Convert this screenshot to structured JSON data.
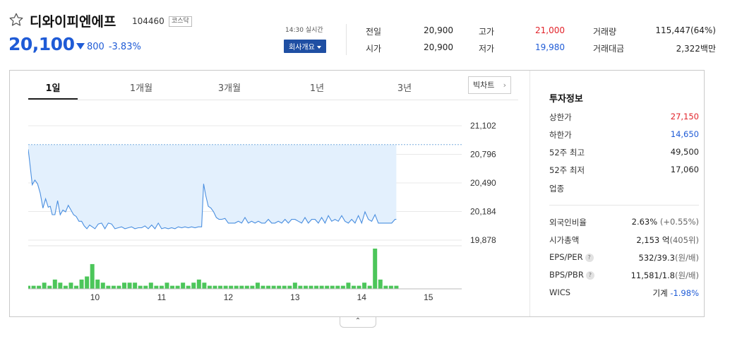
{
  "stock": {
    "name": "디와이피엔에프",
    "code": "104460",
    "market": "코스닥",
    "price": "20,100",
    "change": "800",
    "change_pct": "-3.83%",
    "realtime": "14:30 실시간",
    "company_btn": "회사개요"
  },
  "quotes": [
    {
      "label": "전일",
      "value": "20,900",
      "color": "normal"
    },
    {
      "label": "고가",
      "value": "21,000",
      "color": "red"
    },
    {
      "label": "거래량",
      "value": "115,447(64%)",
      "color": "normal"
    },
    {
      "label": "시가",
      "value": "20,900",
      "color": "normal"
    },
    {
      "label": "저가",
      "value": "19,980",
      "color": "blue"
    },
    {
      "label": "거래대금",
      "value": "2,322백만",
      "color": "normal"
    }
  ],
  "tabs": [
    {
      "label": "1일",
      "active": true
    },
    {
      "label": "1개월",
      "active": false
    },
    {
      "label": "3개월",
      "active": false
    },
    {
      "label": "1년",
      "active": false
    },
    {
      "label": "3년",
      "active": false
    }
  ],
  "big_chart_btn": "빅차트",
  "invest": {
    "title": "투자정보",
    "rows": [
      {
        "label": "상한가",
        "value": "27,150",
        "color": "red"
      },
      {
        "label": "하한가",
        "value": "14,650",
        "color": "blue"
      },
      {
        "label": "52주 최고",
        "value": "49,500"
      },
      {
        "label": "52주 최저",
        "value": "17,060"
      },
      {
        "label": "업종",
        "value": ""
      }
    ],
    "rows2": [
      {
        "label": "외국인비율",
        "value": "2.63%",
        "sub": "(+0.55%)"
      },
      {
        "label": "시가총액",
        "value": "2,153 억",
        "sub": "(405위)"
      },
      {
        "label": "EPS/PER",
        "value": "532/39.3",
        "sub": "(원/배)",
        "help": "?"
      },
      {
        "label": "BPS/PBR",
        "value": "11,581/1.8",
        "sub": "(원/배)",
        "help": "?"
      },
      {
        "label": "WICS",
        "value": "기계",
        "sub": "-1.98%"
      }
    ]
  },
  "chart_data": {
    "type": "line",
    "y_ticks": [
      "21,102",
      "20,796",
      "20,490",
      "20,184",
      "19,878"
    ],
    "ylim": [
      19878,
      21102
    ],
    "prev_close": 20900,
    "x_ticks": [
      "10",
      "11",
      "12",
      "13",
      "14",
      "15"
    ],
    "x_range": [
      9,
      15.5
    ],
    "price_series": [
      [
        9.0,
        20850
      ],
      [
        9.06,
        20470
      ],
      [
        9.1,
        20520
      ],
      [
        9.14,
        20480
      ],
      [
        9.18,
        20380
      ],
      [
        9.22,
        20220
      ],
      [
        9.26,
        20320
      ],
      [
        9.3,
        20230
      ],
      [
        9.33,
        20240
      ],
      [
        9.36,
        20150
      ],
      [
        9.4,
        20150
      ],
      [
        9.44,
        20300
      ],
      [
        9.48,
        20150
      ],
      [
        9.52,
        20200
      ],
      [
        9.56,
        20180
      ],
      [
        9.6,
        20250
      ],
      [
        9.64,
        20200
      ],
      [
        9.68,
        20150
      ],
      [
        9.72,
        20130
      ],
      [
        9.76,
        20080
      ],
      [
        9.8,
        20080
      ],
      [
        9.84,
        20030
      ],
      [
        9.88,
        20000
      ],
      [
        9.92,
        20040
      ],
      [
        9.96,
        20020
      ],
      [
        10.0,
        20000
      ],
      [
        10.05,
        20050
      ],
      [
        10.1,
        20060
      ],
      [
        10.15,
        20000
      ],
      [
        10.2,
        20060
      ],
      [
        10.25,
        20050
      ],
      [
        10.3,
        20000
      ],
      [
        10.35,
        20010
      ],
      [
        10.4,
        20020
      ],
      [
        10.45,
        20000
      ],
      [
        10.5,
        20010
      ],
      [
        10.55,
        20020
      ],
      [
        10.6,
        20000
      ],
      [
        10.65,
        20010
      ],
      [
        10.7,
        20010
      ],
      [
        10.75,
        20030
      ],
      [
        10.8,
        20000
      ],
      [
        10.85,
        20040
      ],
      [
        10.9,
        20000
      ],
      [
        10.95,
        20060
      ],
      [
        11.0,
        20000
      ],
      [
        11.05,
        20010
      ],
      [
        11.1,
        20000
      ],
      [
        11.15,
        20010
      ],
      [
        11.2,
        20000
      ],
      [
        11.25,
        20020
      ],
      [
        11.3,
        20010
      ],
      [
        11.35,
        20020
      ],
      [
        11.4,
        20010
      ],
      [
        11.45,
        20020
      ],
      [
        11.5,
        20010
      ],
      [
        11.55,
        20020
      ],
      [
        11.6,
        20020
      ],
      [
        11.63,
        20480
      ],
      [
        11.66,
        20360
      ],
      [
        11.7,
        20240
      ],
      [
        11.74,
        20220
      ],
      [
        11.78,
        20180
      ],
      [
        11.82,
        20120
      ],
      [
        11.86,
        20100
      ],
      [
        11.9,
        20100
      ],
      [
        11.95,
        20110
      ],
      [
        12.0,
        20060
      ],
      [
        12.05,
        20060
      ],
      [
        12.1,
        20060
      ],
      [
        12.15,
        20080
      ],
      [
        12.2,
        20060
      ],
      [
        12.25,
        20120
      ],
      [
        12.3,
        20060
      ],
      [
        12.35,
        20080
      ],
      [
        12.4,
        20060
      ],
      [
        12.45,
        20080
      ],
      [
        12.5,
        20060
      ],
      [
        12.55,
        20060
      ],
      [
        12.6,
        20100
      ],
      [
        12.65,
        20060
      ],
      [
        12.7,
        20060
      ],
      [
        12.75,
        20080
      ],
      [
        12.8,
        20060
      ],
      [
        12.85,
        20100
      ],
      [
        12.9,
        20060
      ],
      [
        12.95,
        20100
      ],
      [
        13.0,
        20100
      ],
      [
        13.05,
        20080
      ],
      [
        13.1,
        20060
      ],
      [
        13.15,
        20120
      ],
      [
        13.2,
        20060
      ],
      [
        13.25,
        20100
      ],
      [
        13.3,
        20100
      ],
      [
        13.35,
        20060
      ],
      [
        13.4,
        20120
      ],
      [
        13.45,
        20060
      ],
      [
        13.5,
        20140
      ],
      [
        13.55,
        20080
      ],
      [
        13.6,
        20100
      ],
      [
        13.65,
        20080
      ],
      [
        13.7,
        20140
      ],
      [
        13.75,
        20080
      ],
      [
        13.8,
        20060
      ],
      [
        13.85,
        20100
      ],
      [
        13.9,
        20060
      ],
      [
        13.95,
        20140
      ],
      [
        14.0,
        20060
      ],
      [
        14.05,
        20180
      ],
      [
        14.1,
        20100
      ],
      [
        14.15,
        20080
      ],
      [
        14.2,
        20150
      ],
      [
        14.25,
        20060
      ],
      [
        14.3,
        20060
      ],
      [
        14.4,
        20060
      ],
      [
        14.45,
        20060
      ],
      [
        14.5,
        20100
      ],
      [
        14.52,
        20100
      ]
    ],
    "volume_series": [
      [
        9.0,
        1
      ],
      [
        9.08,
        1
      ],
      [
        9.16,
        1
      ],
      [
        9.24,
        2
      ],
      [
        9.32,
        1
      ],
      [
        9.4,
        3
      ],
      [
        9.48,
        2
      ],
      [
        9.56,
        1
      ],
      [
        9.64,
        2
      ],
      [
        9.72,
        1
      ],
      [
        9.8,
        3
      ],
      [
        9.88,
        4
      ],
      [
        9.96,
        8
      ],
      [
        10.04,
        3
      ],
      [
        10.12,
        2
      ],
      [
        10.2,
        1
      ],
      [
        10.28,
        1
      ],
      [
        10.36,
        1
      ],
      [
        10.44,
        2
      ],
      [
        10.52,
        2
      ],
      [
        10.6,
        2
      ],
      [
        10.68,
        1
      ],
      [
        10.76,
        1
      ],
      [
        10.84,
        2
      ],
      [
        10.92,
        1
      ],
      [
        11.0,
        1
      ],
      [
        11.08,
        2
      ],
      [
        11.16,
        1
      ],
      [
        11.24,
        1
      ],
      [
        11.32,
        2
      ],
      [
        11.4,
        1
      ],
      [
        11.48,
        2
      ],
      [
        11.56,
        3
      ],
      [
        11.64,
        2
      ],
      [
        11.72,
        1
      ],
      [
        11.8,
        1
      ],
      [
        11.88,
        1
      ],
      [
        11.96,
        1
      ],
      [
        12.04,
        1
      ],
      [
        12.12,
        1
      ],
      [
        12.2,
        1
      ],
      [
        12.28,
        1
      ],
      [
        12.36,
        1
      ],
      [
        12.44,
        2
      ],
      [
        12.52,
        1
      ],
      [
        12.6,
        1
      ],
      [
        12.68,
        1
      ],
      [
        12.76,
        1
      ],
      [
        12.84,
        1
      ],
      [
        12.92,
        1
      ],
      [
        13.0,
        2
      ],
      [
        13.08,
        1
      ],
      [
        13.16,
        1
      ],
      [
        13.24,
        1
      ],
      [
        13.32,
        1
      ],
      [
        13.4,
        1
      ],
      [
        13.48,
        1
      ],
      [
        13.56,
        1
      ],
      [
        13.64,
        1
      ],
      [
        13.72,
        1
      ],
      [
        13.8,
        2
      ],
      [
        13.88,
        1
      ],
      [
        13.96,
        1
      ],
      [
        14.04,
        2
      ],
      [
        14.12,
        1
      ],
      [
        14.2,
        13
      ],
      [
        14.28,
        3
      ],
      [
        14.36,
        1
      ],
      [
        14.44,
        1
      ],
      [
        14.52,
        1
      ]
    ]
  }
}
